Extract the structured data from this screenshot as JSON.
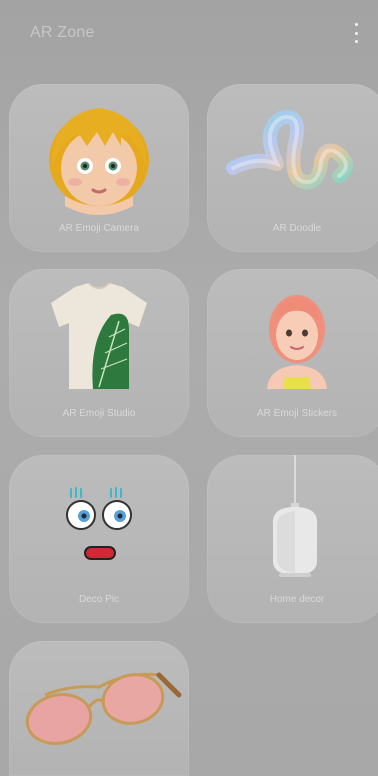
{
  "header": {
    "title": "AR Zone",
    "more_icon": "more-vertical-icon"
  },
  "tiles": [
    {
      "label": "AR Emoji Camera",
      "icon": "emoji-avatar-icon"
    },
    {
      "label": "AR Doodle",
      "icon": "doodle-squiggle-icon"
    },
    {
      "label": "AR Emoji Studio",
      "icon": "tshirt-icon"
    },
    {
      "label": "AR Emoji Stickers",
      "icon": "sticker-avatar-icon"
    },
    {
      "label": "Deco Pic",
      "icon": "deco-face-icon"
    },
    {
      "label": "Home decor",
      "icon": "pendant-lamp-icon"
    },
    {
      "label": "",
      "icon": "sunglasses-icon"
    }
  ]
}
